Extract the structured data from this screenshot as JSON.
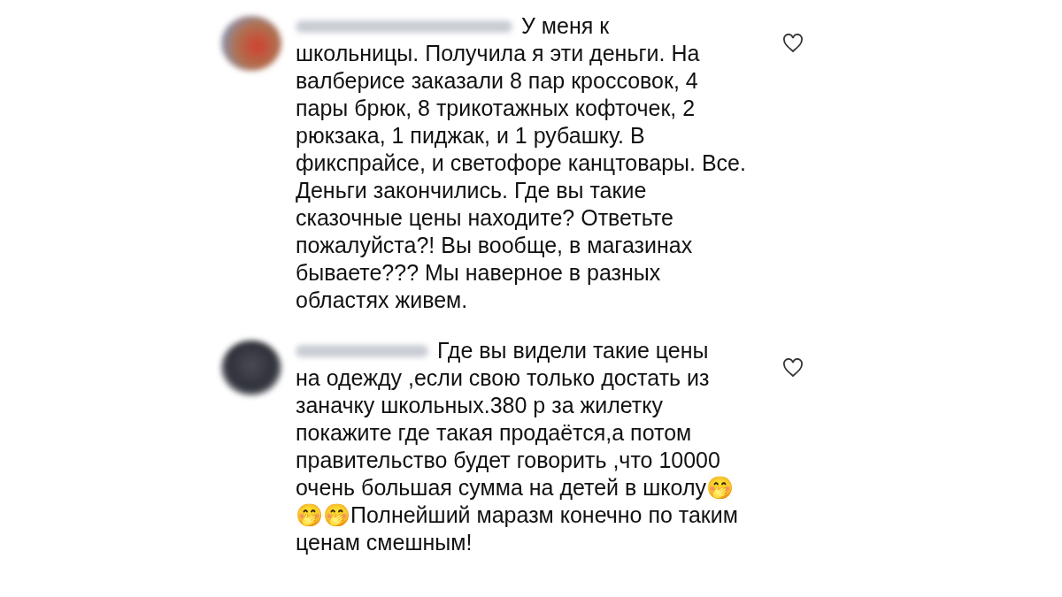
{
  "comments": [
    {
      "text_start": "У меня к",
      "text": "школьницы. Получила я эти деньги. На валберисе заказали 8 пар кроссовок, 4 пары брюк, 8 трикотажных кофточек, 2 рюкзака, 1 пиджак, и 1 рубашку. В фикспрайсе, и светофоре канцтовары. Все. Деньги закончились. Где вы такие сказочные цены находите? Ответьте пожалуйста?! Вы вообще, в магазинах бываете??? Мы наверное в разных областях живем.",
      "liked": false
    },
    {
      "text_start": "Где вы видели такие цены",
      "text": "на одежду ,если свою только достать из заначку школьных.380 р за жилетку покажите где такая продаётся,а потом правительство будет говорить ,что 10000 очень большая сумма на детей в школу🤭🤭🤭Полнейший маразм конечно по таким ценам смешным!",
      "liked": false
    }
  ]
}
